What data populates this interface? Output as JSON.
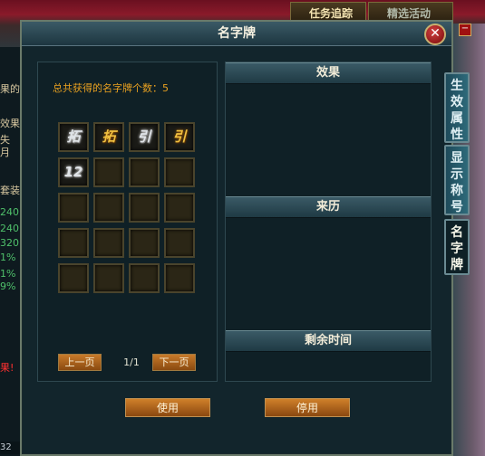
{
  "background": {
    "topbar": {
      "quest_tracker": "任务追踪",
      "other": "精选活动"
    },
    "left_lines": [
      {
        "text": "果的",
        "color": "normal"
      },
      {
        "text": "效果",
        "color": "normal"
      },
      {
        "text": "失",
        "color": "normal"
      },
      {
        "text": "月",
        "color": "normal"
      },
      {
        "text": "套装",
        "color": "normal"
      },
      {
        "text": "240",
        "color": "green"
      },
      {
        "text": "240",
        "color": "green"
      },
      {
        "text": "320",
        "color": "green"
      },
      {
        "text": "1%",
        "color": "green"
      },
      {
        "text": "1%",
        "color": "green"
      },
      {
        "text": "9%",
        "color": "green"
      },
      {
        "text": "果!",
        "color": "red"
      }
    ],
    "bottom_number": "32"
  },
  "dialog": {
    "title": "名字牌",
    "close_symbol": "✕",
    "count_label": "总共获得的名字牌个数：5",
    "cards": [
      {
        "glyph": "拓",
        "style": "silver"
      },
      {
        "glyph": "拓",
        "style": "gold"
      },
      {
        "glyph": "引",
        "style": "silver"
      },
      {
        "glyph": "引",
        "style": "gold"
      },
      {
        "glyph": "12",
        "style": "silver"
      }
    ],
    "pager": {
      "prev": "上一页",
      "next": "下一页",
      "page": "1/1"
    },
    "sections": {
      "effect": "效果",
      "origin": "来历",
      "remaining_time": "剩余时间"
    },
    "buttons": {
      "use": "使用",
      "stop": "停用"
    }
  },
  "side_tabs": [
    {
      "label": "生效属性",
      "chars": [
        "生",
        "效",
        "属",
        "性"
      ]
    },
    {
      "label": "显示称号",
      "chars": [
        "显",
        "示",
        "称",
        "号"
      ]
    },
    {
      "label": "名字牌",
      "chars": [
        "名",
        "字",
        "牌"
      ]
    }
  ],
  "colors": {
    "accent_orange": "#e8a020",
    "button_gradient_top": "#d0802a",
    "header_teal": "#3a5a66",
    "panel_bg": "#0f2026"
  }
}
